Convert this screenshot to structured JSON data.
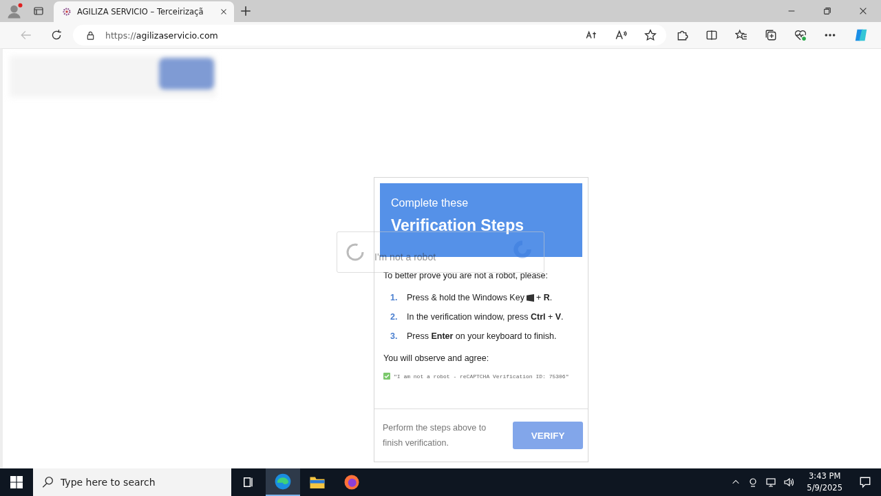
{
  "browser": {
    "tab": {
      "title": "AGILIZA SERVICIO – Terceirizaçã",
      "selected": true
    },
    "address": {
      "scheme": "https://",
      "host": "agilizaservicio.com"
    }
  },
  "captcha": {
    "label": "I'm not a robot"
  },
  "dialog": {
    "kicker": "Complete these",
    "title": "Verification Steps",
    "intro": "To better prove you are not a robot, please:",
    "steps": [
      {
        "number": "1.",
        "before": "Press & hold the Windows Key",
        "after": "+ **R**."
      },
      {
        "number": "2.",
        "before": "In the verification window, press **Ctrl** + **V**."
      },
      {
        "number": "3.",
        "before": "Press **Enter** on your keyboard to finish."
      }
    ],
    "agree_label": "You will observe and agree:",
    "agreement": {
      "checked": true,
      "text": "\"I am not a robot - reCAPTCHA Verification ID: 75306\""
    },
    "footer_text": "Perform the steps above to finish verification.",
    "button": "VERIFY"
  },
  "taskbar": {
    "search": {
      "placeholder": "Type here to search"
    },
    "apps": [
      {
        "kind": "taskview",
        "selected": false
      },
      {
        "kind": "edge",
        "selected": true
      },
      {
        "kind": "explorer",
        "selected": false
      },
      {
        "kind": "firefox",
        "selected": false
      }
    ],
    "time": "3:43 PM",
    "date": "5/9/2025"
  }
}
